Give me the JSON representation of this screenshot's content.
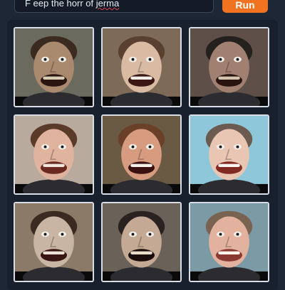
{
  "prompt": {
    "text_before": "F eep the horr of ",
    "text_misspelled": "jerma"
  },
  "run_button": {
    "label": "Run"
  },
  "results": [
    {
      "bg": "#6b6a5e",
      "skin": "#a98a6e",
      "hair": "#3a2a20",
      "mouth": "#2a1510",
      "teeth": "#d8cbb4",
      "label": "generated-image-1"
    },
    {
      "bg": "#7d6b58",
      "skin": "#d9bba4",
      "hair": "#5a4030",
      "mouth": "#3a1512",
      "teeth": "#f0ece6",
      "label": "generated-image-2"
    },
    {
      "bg": "#5e5048",
      "skin": "#a08070",
      "hair": "#24201e",
      "mouth": "#2a1410",
      "teeth": "#d4c4b0",
      "label": "generated-image-3"
    },
    {
      "bg": "#b8aa9c",
      "skin": "#dfb39e",
      "hair": "#5a3a28",
      "mouth": "#6a2a22",
      "teeth": "#f2e7dd",
      "label": "generated-image-4"
    },
    {
      "bg": "#6a5a44",
      "skin": "#d79c80",
      "hair": "#6b4028",
      "mouth": "#3a1010",
      "teeth": "#f4f0ea",
      "label": "generated-image-5"
    },
    {
      "bg": "#8ec7d9",
      "skin": "#e9c5b3",
      "hair": "#6a5a50",
      "mouth": "#802a22",
      "teeth": "#faf4ee",
      "label": "generated-image-6"
    },
    {
      "bg": "#8b7a68",
      "skin": "#c9b5a4",
      "hair": "#3a2a22",
      "mouth": "#3a1612",
      "teeth": "#eae0d4",
      "label": "generated-image-7"
    },
    {
      "bg": "#6a6258",
      "skin": "#c4aa94",
      "hair": "#2a2220",
      "mouth": "#1a0c0a",
      "teeth": "#e8dccc",
      "label": "generated-image-8"
    },
    {
      "bg": "#7c9aa6",
      "skin": "#e2b29e",
      "hair": "#7a6250",
      "mouth": "#8a3a32",
      "teeth": "#fbf5ee",
      "label": "generated-image-9"
    }
  ]
}
